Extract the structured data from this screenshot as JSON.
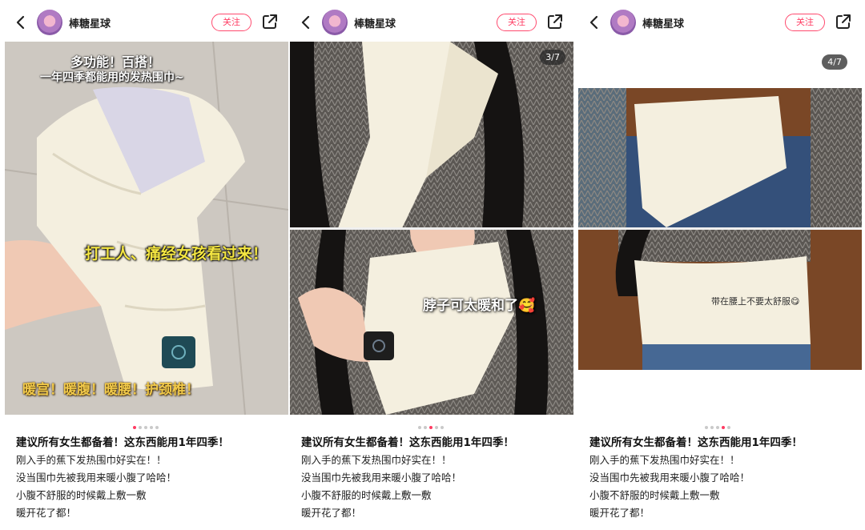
{
  "header": {
    "author": "棒糖星球",
    "follow_label": "关注"
  },
  "panels": [
    {
      "counter": "",
      "overlay": {
        "title1": "多功能！百搭！",
        "title2": "一年四季都能用的发热围巾~",
        "mid": "打工人、痛经女孩看过来！",
        "bottom": "暖宫！暖腹！暖腰！护颈椎！"
      },
      "active_dot": 0
    },
    {
      "counter": "3/7",
      "overlay": {
        "neck": "脖子可太暖和了🥰"
      },
      "active_dot": 2
    },
    {
      "counter": "4/7",
      "overlay": {
        "belly": "带在腰上不要太舒服😋"
      },
      "active_dot": 3
    }
  ],
  "post": {
    "title": "建议所有女生都备着！这东西能用1年四季！",
    "lines": [
      "刚入手的蕉下发热围巾好实在！！",
      "没当围巾先被我用来暖小腹了哈哈！",
      "小腹不舒服的时候戴上敷一敷",
      "暖开花了都！"
    ]
  },
  "colors": {
    "accent": "#ff3b62",
    "scarf": "#f4efdf",
    "control_button": "#1f4a55"
  },
  "icons": [
    "back-chevron-icon",
    "share-icon"
  ]
}
